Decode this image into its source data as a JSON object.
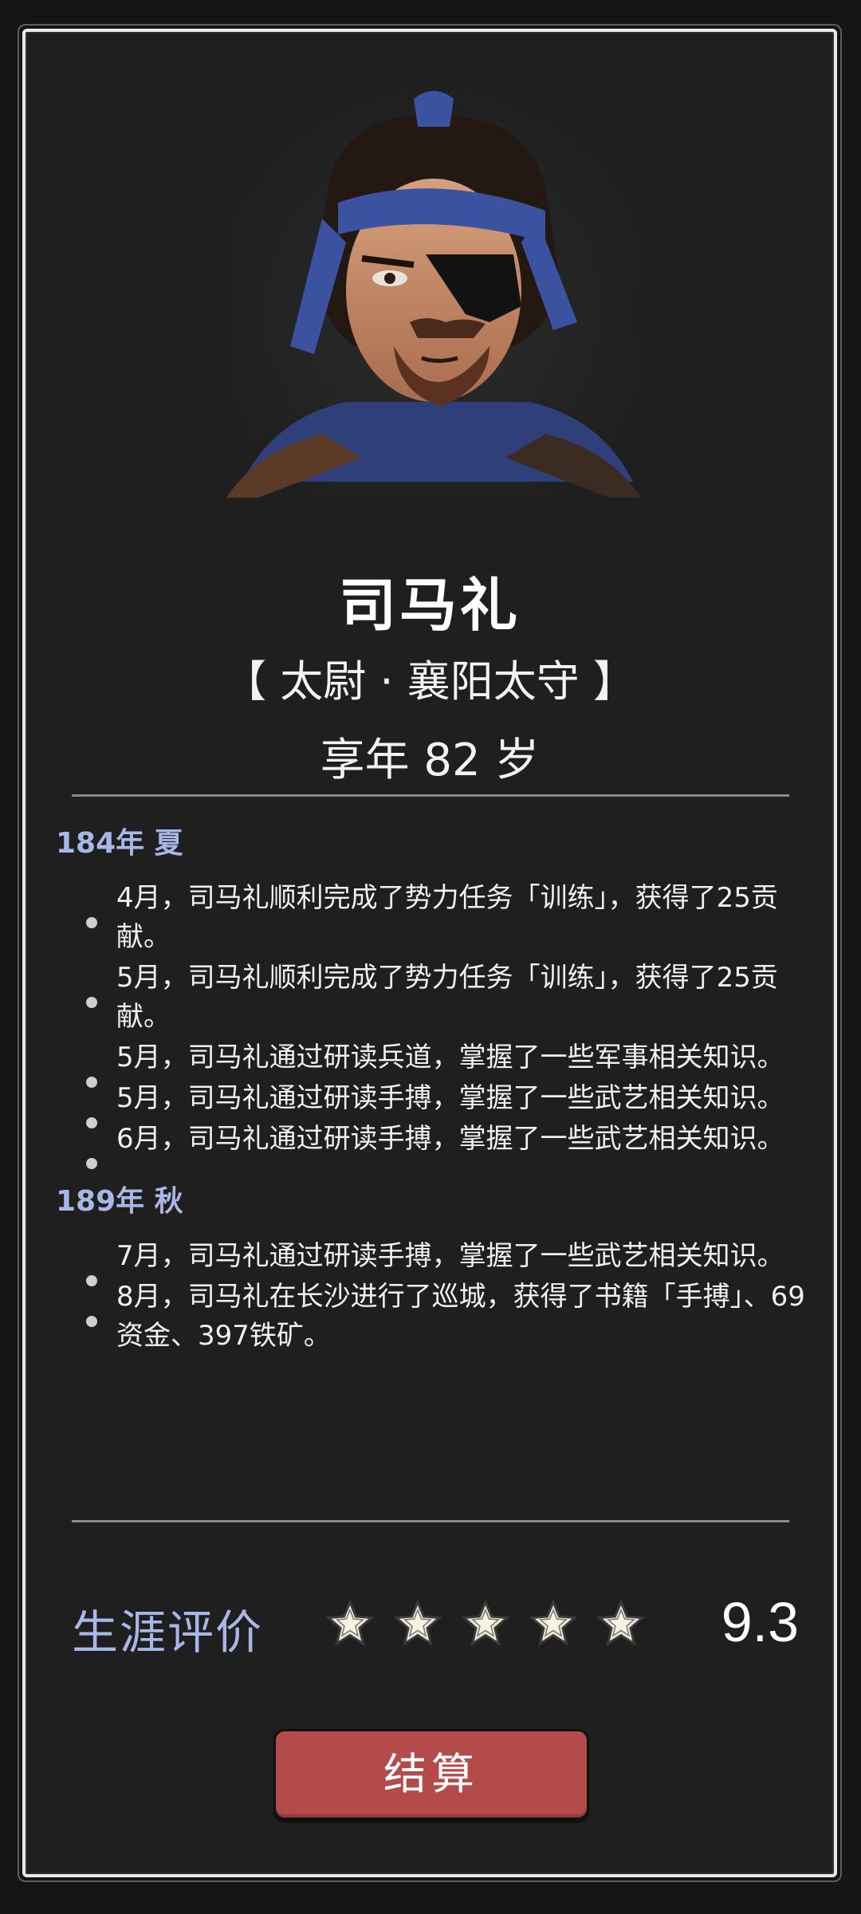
{
  "character": {
    "name": "司马礼",
    "titles": "【 太尉 · 襄阳太守 】",
    "age": "享年 82 岁"
  },
  "log": {
    "groups": [
      {
        "season": "184年 夏",
        "entries": [
          "4月，司马礼顺利完成了势力任务「训练」，获得了25贡献。",
          "5月，司马礼顺利完成了势力任务「训练」，获得了25贡献。",
          "5月，司马礼通过研读兵道，掌握了一些军事相关知识。",
          "5月，司马礼通过研读手搏，掌握了一些武艺相关知识。",
          "6月，司马礼通过研读手搏，掌握了一些武艺相关知识。"
        ]
      },
      {
        "season": "189年 秋",
        "entries": [
          "7月，司马礼通过研读手搏，掌握了一些武艺相关知识。",
          "8月，司马礼在长沙进行了巡城，获得了书籍「手搏」、69资金、397铁矿。"
        ]
      }
    ]
  },
  "rating": {
    "label": "生涯评价",
    "score": "9.3",
    "stars": 5,
    "max_stars": 5
  },
  "button": {
    "label": "结算"
  },
  "colors": {
    "background": "#1f1f1f",
    "accent_blue": "#a9b7e8",
    "button_red": "#b34b4b",
    "text": "#f0f0f0"
  },
  "icons": {
    "star": "star-icon",
    "bullet": "bullet-dot-icon"
  }
}
